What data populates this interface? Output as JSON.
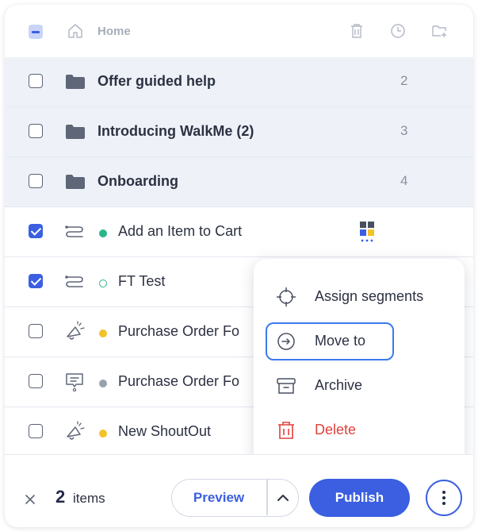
{
  "header": {
    "home_label": "Home",
    "icons": [
      "home-icon",
      "trash-icon",
      "clock-icon",
      "new-folder-icon"
    ]
  },
  "rows": [
    {
      "kind": "folder",
      "label": "Offer guided help",
      "count": "2",
      "checked": false
    },
    {
      "kind": "folder",
      "label": "Introducing WalkMe (2)",
      "count": "3",
      "checked": false
    },
    {
      "kind": "folder",
      "label": "Onboarding",
      "count": "4",
      "checked": false
    },
    {
      "kind": "item",
      "type_icon": "smart-walkthru-icon",
      "status": "published",
      "label": "Add an Item to Cart",
      "checked": true
    },
    {
      "kind": "item",
      "type_icon": "smart-walkthru-icon",
      "status": "draft",
      "label": "FT Test",
      "checked": true
    },
    {
      "kind": "item",
      "type_icon": "shoutout-icon",
      "status": "modified",
      "label": "Purchase Order Fo",
      "checked": false
    },
    {
      "kind": "item",
      "type_icon": "survey-icon",
      "status": "archived",
      "label": "Purchase Order Fo",
      "checked": false
    },
    {
      "kind": "item",
      "type_icon": "shoutout-icon",
      "status": "modified",
      "label": "New ShoutOut",
      "checked": false
    }
  ],
  "menu": {
    "items": [
      {
        "label": "Assign segments",
        "icon": "crosshair-icon"
      },
      {
        "label": "Move to",
        "icon": "arrow-circle-icon"
      },
      {
        "label": "Archive",
        "icon": "archive-icon"
      },
      {
        "label": "Delete",
        "icon": "trash-icon"
      }
    ]
  },
  "footer": {
    "count": "2",
    "count_label": "items",
    "preview_label": "Preview",
    "publish_label": "Publish"
  },
  "colors": {
    "accent": "#3b5fe0",
    "folder_bg": "#eef2f8",
    "status_published": "#2bb58a",
    "status_modified": "#f3c229",
    "status_archived": "#9aa1ae",
    "danger": "#e0413a"
  }
}
